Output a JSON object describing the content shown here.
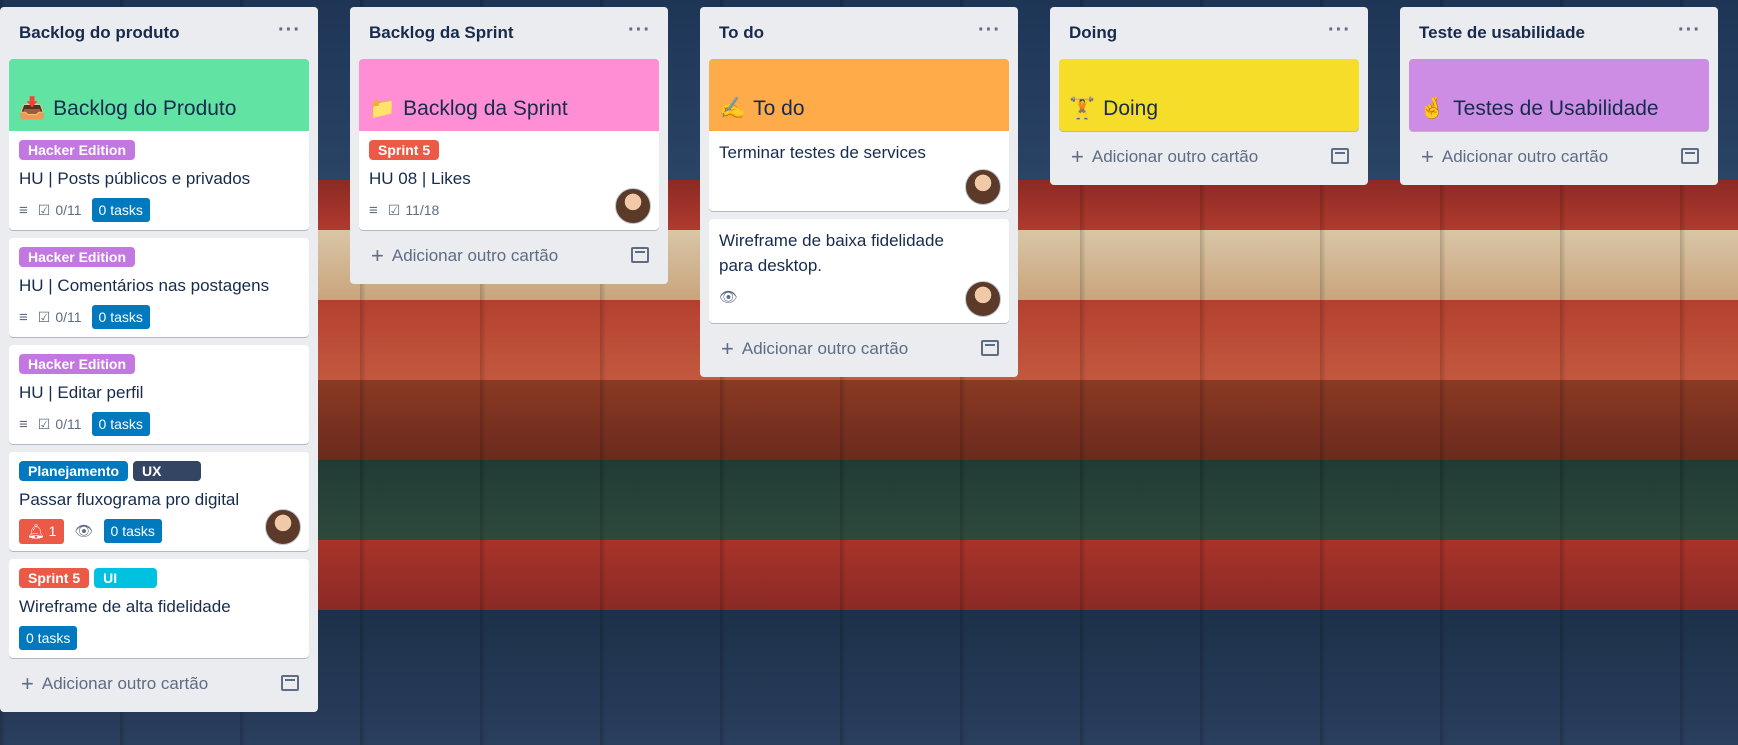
{
  "lists": [
    {
      "title": "Backlog do produto",
      "cover": {
        "title": "Backlog do Produto",
        "emoji": "📥",
        "color": "#61e3a3"
      },
      "cards": [
        {
          "labels": [
            {
              "text": "Hacker Edition",
              "color": "#c377e0"
            }
          ],
          "title": "HU | Posts públicos e privados",
          "checklist": "0/11",
          "tasks": "0 tasks"
        },
        {
          "labels": [
            {
              "text": "Hacker Edition",
              "color": "#c377e0"
            }
          ],
          "title": "HU | Comentários nas postagens",
          "checklist": "0/11",
          "tasks": "0 tasks"
        },
        {
          "labels": [
            {
              "text": "Hacker Edition",
              "color": "#c377e0"
            }
          ],
          "title": "HU | Editar perfil",
          "checklist": "0/11",
          "tasks": "0 tasks"
        },
        {
          "labels": [
            {
              "text": "Planejamento",
              "color": "#0079bf"
            },
            {
              "text": "UX",
              "color": "#344563"
            }
          ],
          "title": "Passar fluxograma pro digital",
          "notifications": "1",
          "tasks": "0 tasks"
        },
        {
          "labels": [
            {
              "text": "Sprint 5",
              "color": "#eb5a46"
            },
            {
              "text": "UI",
              "color": "#00c2e0"
            }
          ],
          "title": "Wireframe de alta fidelidade",
          "tasks": "0 tasks"
        }
      ],
      "add_card": "Adicionar outro cartão"
    },
    {
      "title": "Backlog da Sprint",
      "cover": {
        "title": "Backlog da Sprint",
        "emoji": "📁",
        "color": "#ff8ed4"
      },
      "cards": [
        {
          "labels": [
            {
              "text": "Sprint 5",
              "color": "#eb5a46"
            }
          ],
          "title": "HU 08 | Likes",
          "checklist": "11/18"
        }
      ],
      "add_card": "Adicionar outro cartão"
    },
    {
      "title": "To do",
      "cover": {
        "title": "To do",
        "emoji": "✍️",
        "color": "#ffab4a"
      },
      "cards": [
        {
          "title": "Terminar testes de services"
        },
        {
          "title": "Wireframe de baixa fidelidade para desktop."
        }
      ],
      "add_card": "Adicionar outro cartão"
    },
    {
      "title": "Doing",
      "cover": {
        "title": "Doing",
        "emoji": "🏋️",
        "color": "#f5dd29"
      },
      "add_card": "Adicionar outro cartão"
    },
    {
      "title": "Teste de usabilidade",
      "cover": {
        "title": "Testes de Usabilidade",
        "emoji": "🤞",
        "color": "#cd8de5"
      },
      "add_card": "Adicionar outro cartão"
    }
  ],
  "icons": {
    "list_menu": "ellipsis-icon",
    "description": "description-icon",
    "checklist": "checklist-icon",
    "watch": "eye-icon",
    "notification": "bell-icon",
    "add": "plus-icon",
    "template": "card-template-icon"
  }
}
